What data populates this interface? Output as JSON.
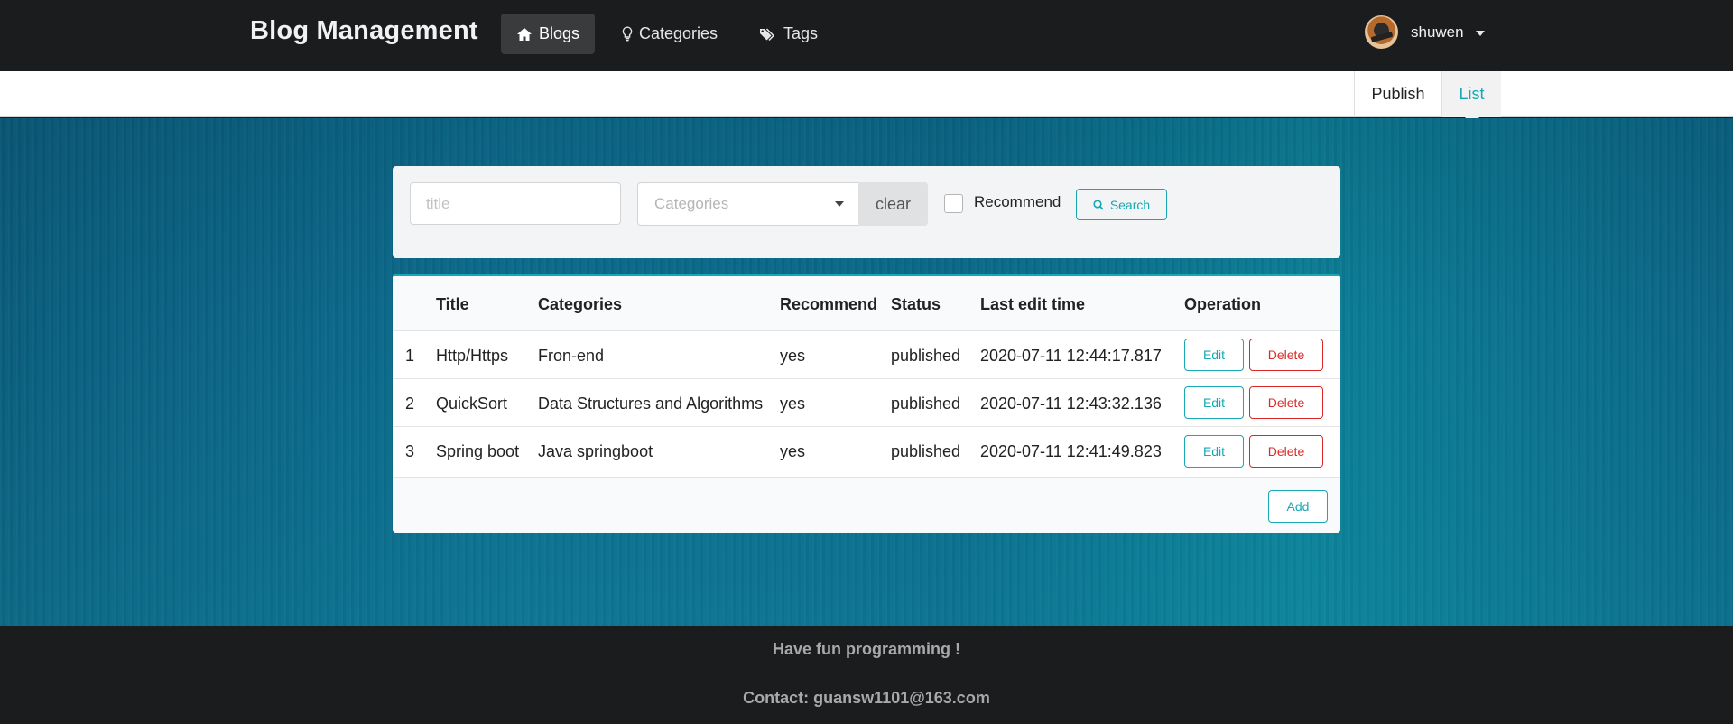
{
  "header": {
    "brand": "Blog Management",
    "nav": [
      {
        "label": "Blogs",
        "icon": "home-icon",
        "active": true
      },
      {
        "label": "Categories",
        "icon": "lightbulb-icon",
        "active": false
      },
      {
        "label": "Tags",
        "icon": "tags-icon",
        "active": false
      }
    ],
    "user": {
      "name": "shuwen"
    }
  },
  "submenu": {
    "items": [
      {
        "label": "Publish",
        "active": false
      },
      {
        "label": "List",
        "active": true
      }
    ]
  },
  "filter": {
    "title_placeholder": "title",
    "title_value": "",
    "categories_placeholder": "Categories",
    "clear_label": "clear",
    "recommend_label": "Recommend",
    "recommend_checked": false,
    "search_label": "Search"
  },
  "table": {
    "columns": [
      "",
      "Title",
      "Categories",
      "Recommend",
      "Status",
      "Last edit time",
      "Operation"
    ],
    "rows": [
      {
        "index": "1",
        "title": "Http/Https",
        "category": "Fron-end",
        "recommend": "yes",
        "status": "published",
        "last_edit": "2020-07-11 12:44:17.817"
      },
      {
        "index": "2",
        "title": "QuickSort",
        "category": "Data Structures and Algorithms",
        "recommend": "yes",
        "status": "published",
        "last_edit": "2020-07-11 12:43:32.136"
      },
      {
        "index": "3",
        "title": "Spring boot",
        "category": "Java springboot",
        "recommend": "yes",
        "status": "published",
        "last_edit": "2020-07-11 12:41:49.823"
      }
    ],
    "edit_label": "Edit",
    "delete_label": "Delete",
    "add_label": "Add"
  },
  "footer": {
    "tagline": "Have fun programming !",
    "contact": "Contact: guansw1101@163.com"
  },
  "colors": {
    "accent": "#18a7b5",
    "danger": "#db2828",
    "nav_bg": "#1b1c1d"
  }
}
